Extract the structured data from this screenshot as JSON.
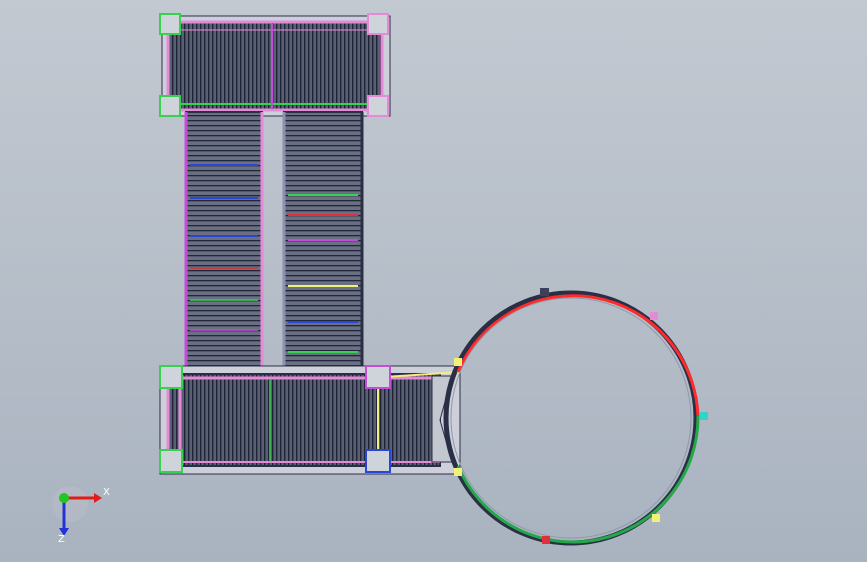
{
  "viewport": {
    "background_top": "#c3c9d1",
    "background_bottom": "#a9b3c0"
  },
  "model": {
    "frame_color": "#2a2f45",
    "slat_color": "#3b4158",
    "belt_pink": "#e58ad6",
    "belt_green": "#37d14f",
    "belt_red": "#e0303a",
    "belt_blue": "#2a46d8",
    "belt_yellow": "#f1f179",
    "turntable_red": "#ff2b2b",
    "turntable_green": "#25a84a"
  },
  "triad": {
    "x_label": "X",
    "z_label": "Z",
    "x_color": "#e21b1b",
    "y_color": "#23c51f",
    "z_color": "#2431d6"
  }
}
